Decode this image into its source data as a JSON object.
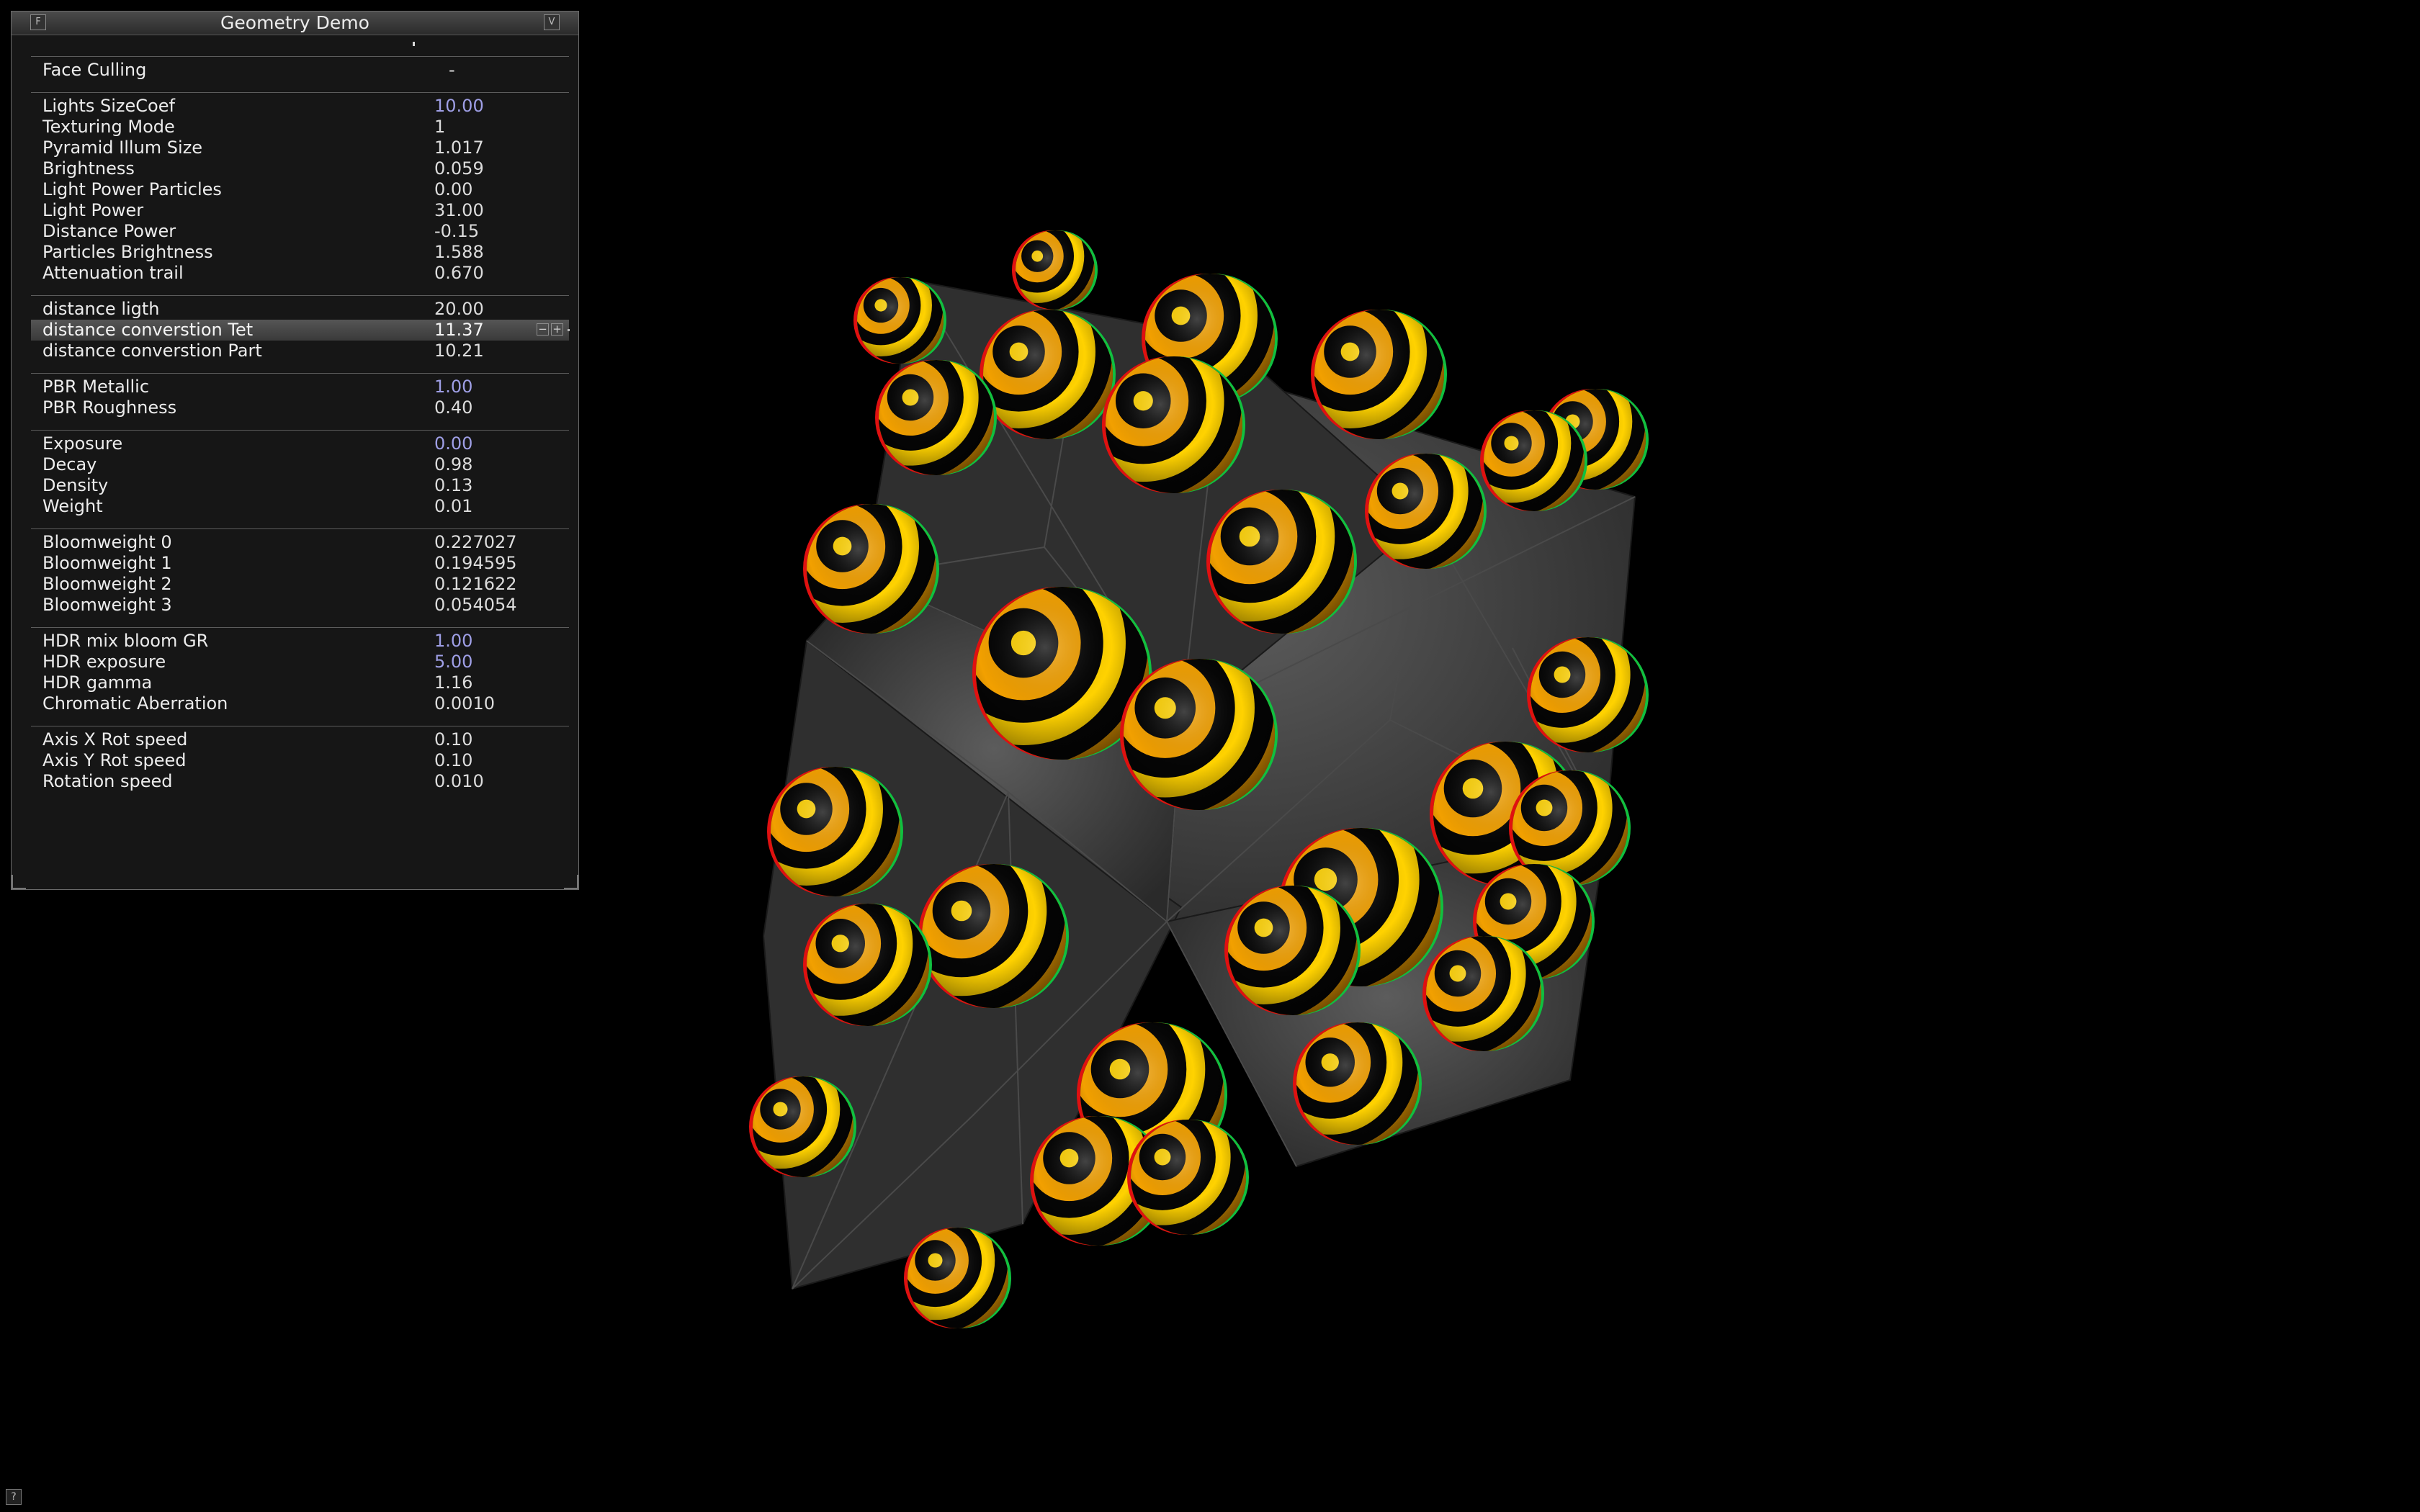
{
  "window": {
    "title": "Geometry Demo",
    "help_glyph": "?",
    "menu_glyph": "F",
    "collapse_glyph": "V"
  },
  "groups": [
    [
      {
        "label": "Face Culling",
        "value": "-",
        "accent": false
      }
    ],
    [
      {
        "label": "Lights SizeCoef",
        "value": "10.00",
        "accent": true
      },
      {
        "label": "Texturing Mode",
        "value": "1",
        "accent": false
      },
      {
        "label": "Pyramid Illum Size",
        "value": "1.017",
        "accent": false
      },
      {
        "label": "Brightness",
        "value": "0.059",
        "accent": false
      },
      {
        "label": "Light Power Particles",
        "value": "0.00",
        "accent": false
      },
      {
        "label": "Light Power",
        "value": "31.00",
        "accent": false
      },
      {
        "label": "Distance Power",
        "value": "-0.15",
        "accent": false
      },
      {
        "label": "Particles Brightness",
        "value": "1.588",
        "accent": false
      },
      {
        "label": "Attenuation trail",
        "value": "0.670",
        "accent": false
      }
    ],
    [
      {
        "label": "distance ligth",
        "value": "20.00",
        "accent": false
      },
      {
        "label": "distance converstion Tet",
        "value": "11.37",
        "accent": false,
        "selected": true
      },
      {
        "label": "distance converstion Part",
        "value": "10.21",
        "accent": false
      }
    ],
    [
      {
        "label": "PBR Metallic",
        "value": "1.00",
        "accent": true
      },
      {
        "label": "PBR Roughness",
        "value": "0.40",
        "accent": false
      }
    ],
    [
      {
        "label": "Exposure",
        "value": "0.00",
        "accent": true
      },
      {
        "label": "Decay",
        "value": "0.98",
        "accent": false
      },
      {
        "label": "Density",
        "value": "0.13",
        "accent": false
      },
      {
        "label": "Weight",
        "value": "0.01",
        "accent": false
      }
    ],
    [
      {
        "label": "Bloomweight 0",
        "value": "0.227027",
        "accent": false
      },
      {
        "label": "Bloomweight 1",
        "value": "0.194595",
        "accent": false
      },
      {
        "label": "Bloomweight 2",
        "value": "0.121622",
        "accent": false
      },
      {
        "label": "Bloomweight 3",
        "value": "0.054054",
        "accent": false
      }
    ],
    [
      {
        "label": "HDR mix bloom GR",
        "value": "1.00",
        "accent": true
      },
      {
        "label": "HDR exposure",
        "value": "5.00",
        "accent": true
      },
      {
        "label": "HDR gamma",
        "value": "1.16",
        "accent": false
      },
      {
        "label": "Chromatic Aberration",
        "value": "0.0010",
        "accent": false
      }
    ],
    [
      {
        "label": "Axis X Rot speed",
        "value": "0.10",
        "accent": false
      },
      {
        "label": "Axis Y Rot speed",
        "value": "0.10",
        "accent": false
      },
      {
        "label": "Rotation speed",
        "value": "0.010",
        "accent": false
      }
    ]
  ],
  "stepper": {
    "minus": "−",
    "plus": "+"
  },
  "colors": {
    "accent_value": "#9f9fe6",
    "sphere_yellow": "#ffd200",
    "sphere_orange": "#f2a000",
    "sphere_black": "#050505",
    "background": "#000000"
  }
}
